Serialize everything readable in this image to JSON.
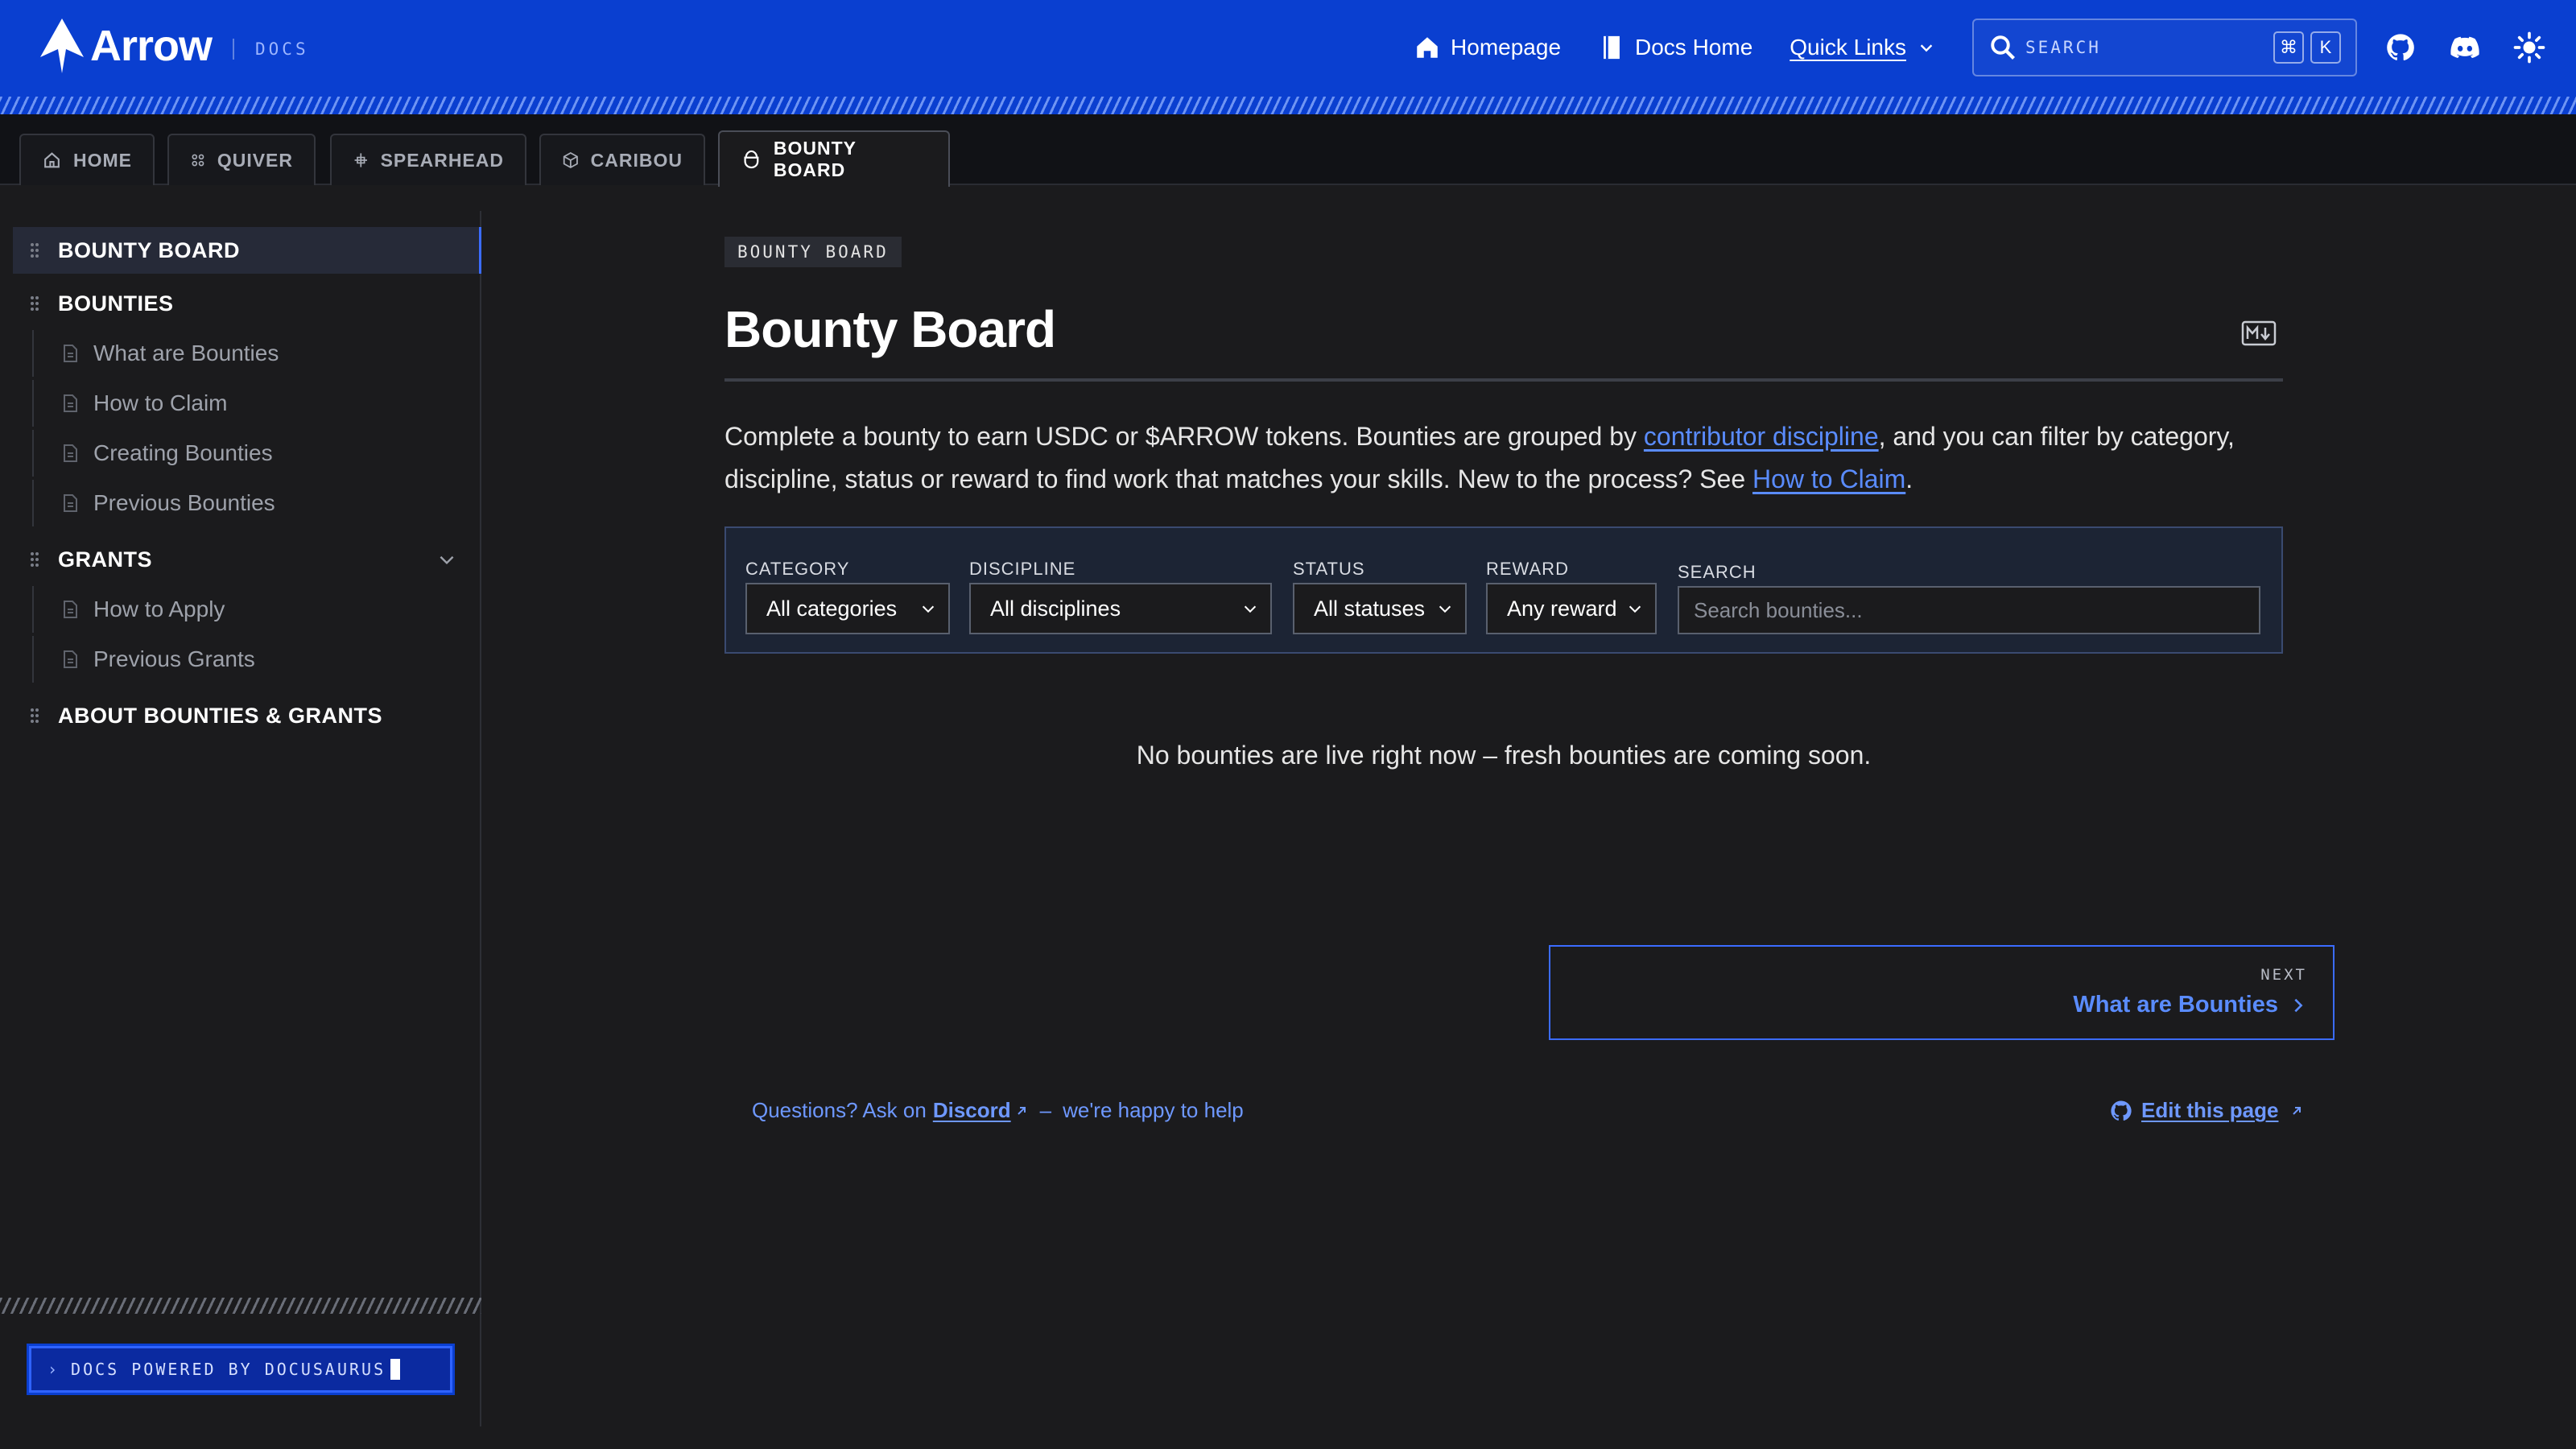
{
  "brand": {
    "name": "Arrow",
    "tag": "DOCS"
  },
  "navbar": {
    "links": [
      {
        "label": "Homepage",
        "icon": "home-icon"
      },
      {
        "label": "Docs Home",
        "icon": "book-icon"
      },
      {
        "label": "Quick Links",
        "icon": "chevron-down-icon"
      }
    ],
    "search": {
      "placeholder": "SEARCH",
      "shortcut_mod": "⌘",
      "shortcut_key": "K"
    },
    "icons": [
      "github-icon",
      "discord-icon",
      "theme-toggle-icon"
    ],
    "colors": {
      "navbar": "#0a3fd0",
      "accent": "#3b6cff",
      "link": "#5a8cff"
    }
  },
  "tabs": [
    {
      "label": "HOME",
      "icon": "home-outline-icon"
    },
    {
      "label": "QUIVER",
      "icon": "quiver-icon"
    },
    {
      "label": "SPEARHEAD",
      "icon": "spearhead-icon"
    },
    {
      "label": "CARIBOU",
      "icon": "cube-icon"
    },
    {
      "label": "BOUNTY BOARD",
      "icon": "bounty-icon",
      "active": true
    }
  ],
  "sidebar": {
    "items": [
      {
        "label": "BOUNTY BOARD",
        "active": true
      },
      {
        "label": "BOUNTIES"
      },
      {
        "label": "What are Bounties"
      },
      {
        "label": "How to Claim"
      },
      {
        "label": "Creating Bounties"
      },
      {
        "label": "Previous Bounties"
      },
      {
        "label": "GRANTS"
      },
      {
        "label": "How to Apply"
      },
      {
        "label": "Previous Grants"
      },
      {
        "label": "ABOUT BOUNTIES & GRANTS"
      }
    ],
    "powered": "DOCS POWERED BY DOCUSAURUS"
  },
  "main": {
    "breadcrumb": "BOUNTY BOARD",
    "title": "Bounty Board",
    "intro": {
      "part1": "Complete a bounty to earn USDC or $ARROW tokens. Bounties are grouped by ",
      "link1": "contributor discipline",
      "part2": ", and you can filter by category, discipline, status or reward to find work that matches your skills. New to the process? See ",
      "link2": "How to Claim",
      "part3": "."
    },
    "filters": {
      "category": {
        "label": "CATEGORY",
        "value": "All categories"
      },
      "discipline": {
        "label": "DISCIPLINE",
        "value": "All disciplines"
      },
      "status": {
        "label": "STATUS",
        "value": "All statuses"
      },
      "reward": {
        "label": "REWARD",
        "value": "Any reward"
      },
      "search": {
        "label": "SEARCH",
        "placeholder": "Search bounties..."
      }
    },
    "empty_state": "No bounties are live right now  –  fresh bounties are coming soon.",
    "next": {
      "sub": "NEXT",
      "label": "What are Bounties"
    },
    "footer": {
      "question": "Questions? Ask on",
      "discord": "Discord",
      "dash": "–",
      "help": "we're happy to help",
      "edit": "Edit this page"
    }
  }
}
